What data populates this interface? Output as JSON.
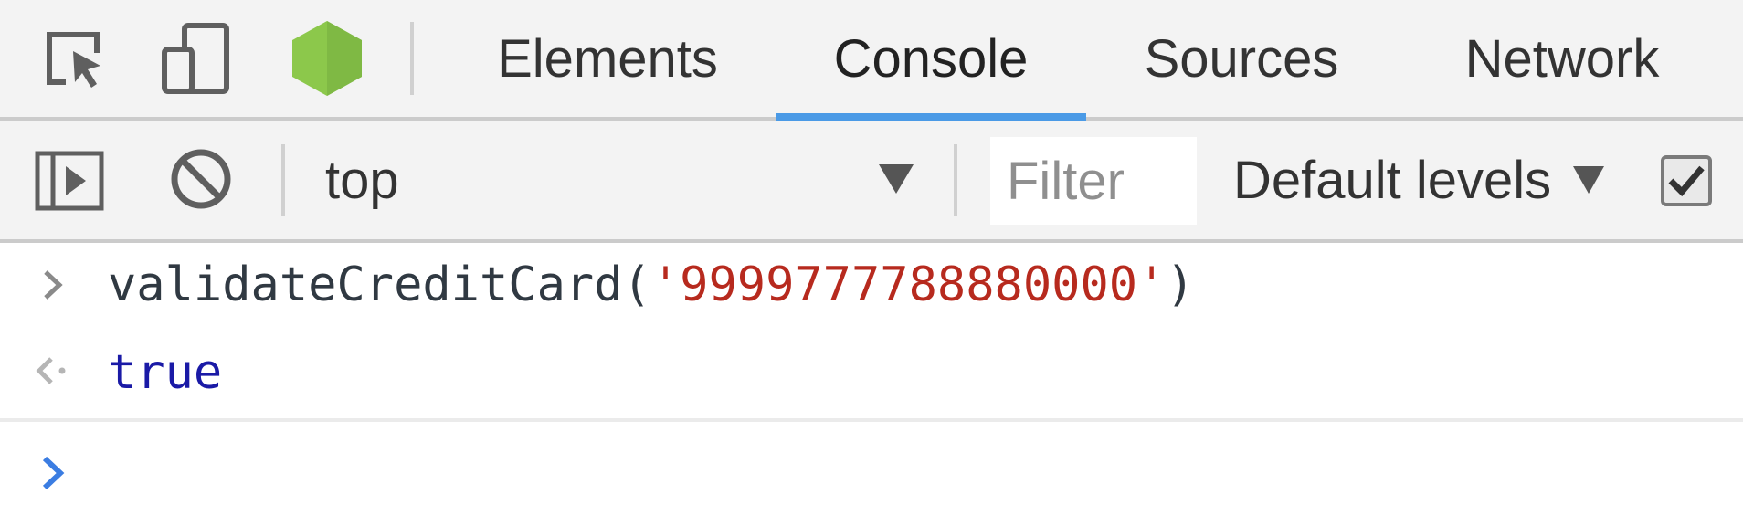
{
  "tabs": [
    {
      "label": "Elements",
      "active": false
    },
    {
      "label": "Console",
      "active": true
    },
    {
      "label": "Sources",
      "active": false
    },
    {
      "label": "Network",
      "active": false
    }
  ],
  "tool_icons": [
    "inspect-element-icon",
    "device-toolbar-icon",
    "node-hexagon-icon"
  ],
  "toolbar": {
    "context": "top",
    "filter_placeholder": "Filter",
    "levels_label": "Default levels",
    "group_similar_checked": true
  },
  "console": {
    "input": {
      "function": "validateCreditCard",
      "open_paren": "(",
      "argument": "'9999777788880000'",
      "close_paren": ")"
    },
    "result": "true"
  },
  "colors": {
    "tab_active_underline": "#4a9ae6",
    "string_token": "#b72a1e",
    "boolean_token": "#1a1aa6",
    "prompt_caret": "#3b7de2",
    "node_icon": "#8cc84b"
  }
}
